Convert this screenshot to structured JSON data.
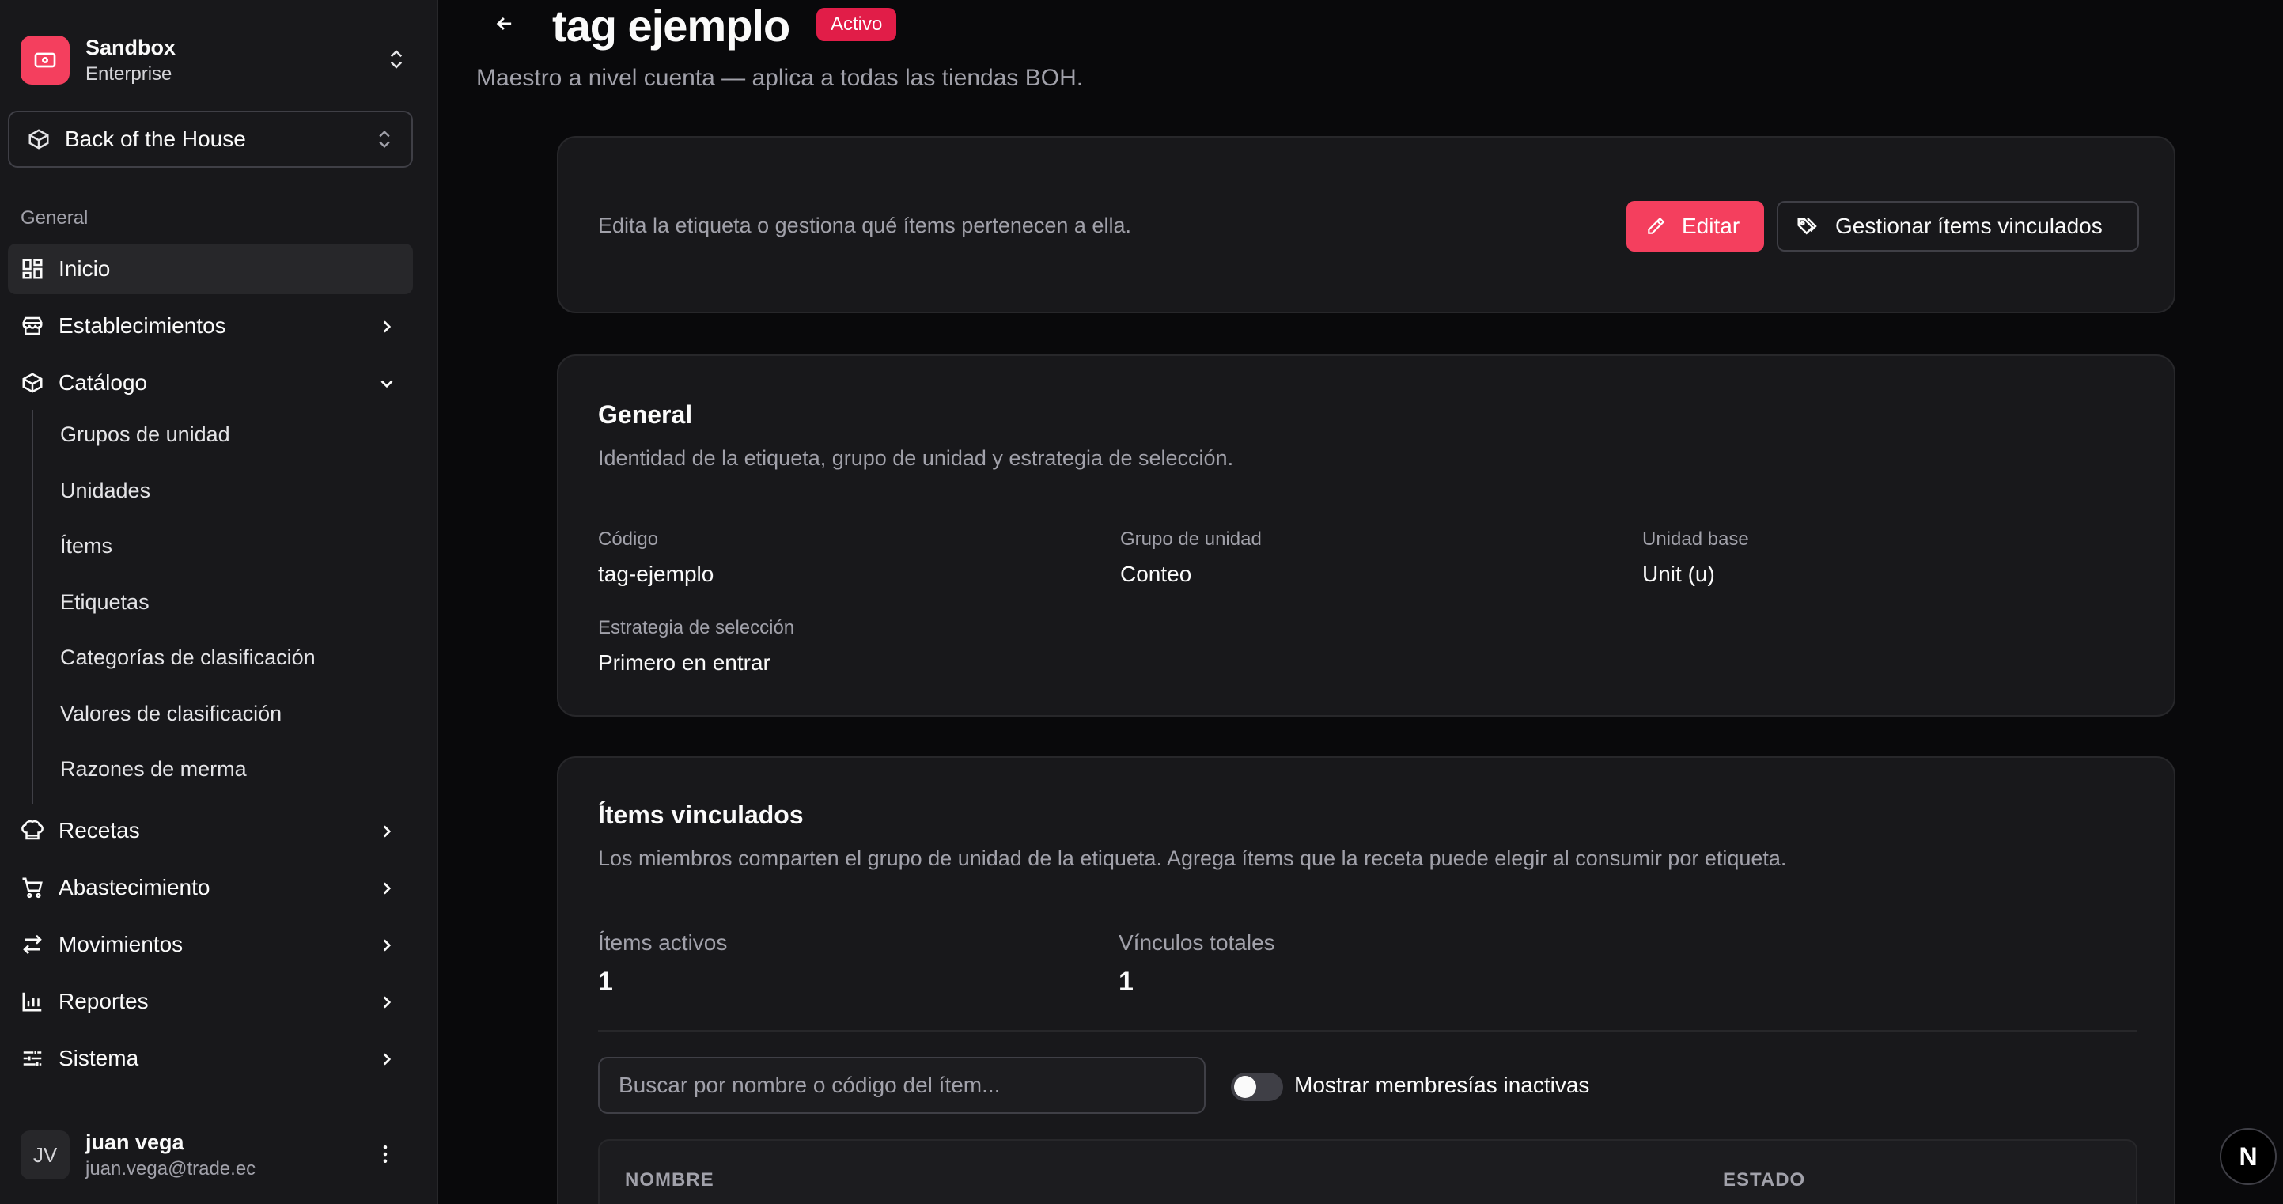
{
  "sidebar": {
    "org": {
      "name": "Sandbox",
      "plan": "Enterprise"
    },
    "store": "Back of the House",
    "section": "General",
    "items": [
      {
        "label": "Inicio",
        "icon": "grid-icon"
      },
      {
        "label": "Establecimientos",
        "icon": "store-icon"
      },
      {
        "label": "Catálogo",
        "icon": "box-icon"
      },
      {
        "label": "Recetas",
        "icon": "chef-hat-icon"
      },
      {
        "label": "Abastecimiento",
        "icon": "cart-icon"
      },
      {
        "label": "Movimientos",
        "icon": "arrows-icon"
      },
      {
        "label": "Reportes",
        "icon": "bar-chart-icon"
      },
      {
        "label": "Sistema",
        "icon": "sliders-icon"
      }
    ],
    "catalog_sub": [
      "Grupos de unidad",
      "Unidades",
      "Ítems",
      "Etiquetas",
      "Categorías de clasificación",
      "Valores de clasificación",
      "Razones de merma"
    ],
    "user": {
      "initials": "JV",
      "name": "juan vega",
      "email": "juan.vega@trade.ec"
    }
  },
  "header": {
    "title": "tag ejemplo",
    "status": "Activo",
    "subtitle": "Maestro a nivel cuenta — aplica a todas las tiendas BOH."
  },
  "actions": {
    "text": "Edita la etiqueta o gestiona qué ítems pertenecen a ella.",
    "edit": "Editar",
    "manage": "Gestionar ítems vinculados"
  },
  "general": {
    "title": "General",
    "desc": "Identidad de la etiqueta, grupo de unidad y estrategia de selección.",
    "fields": [
      {
        "label": "Código",
        "value": "tag-ejemplo"
      },
      {
        "label": "Grupo de unidad",
        "value": "Conteo"
      },
      {
        "label": "Unidad base",
        "value": "Unit (u)"
      },
      {
        "label": "Estrategia de selección",
        "value": "Primero en entrar"
      }
    ]
  },
  "linked": {
    "title": "Ítems vinculados",
    "desc": "Los miembros comparten el grupo de unidad de la etiqueta. Agrega ítems que la receta puede elegir al consumir por etiqueta.",
    "stats": [
      {
        "label": "Ítems activos",
        "value": "1"
      },
      {
        "label": "Vínculos totales",
        "value": "1"
      }
    ],
    "search_placeholder": "Buscar por nombre o código del ítem...",
    "toggle_label": "Mostrar membresías inactivas",
    "columns": [
      "NOMBRE",
      "ESTADO"
    ]
  },
  "fab": "N",
  "colors": {
    "accent": "#f43f5e",
    "bg": "#09090b",
    "card": "#18181b"
  }
}
